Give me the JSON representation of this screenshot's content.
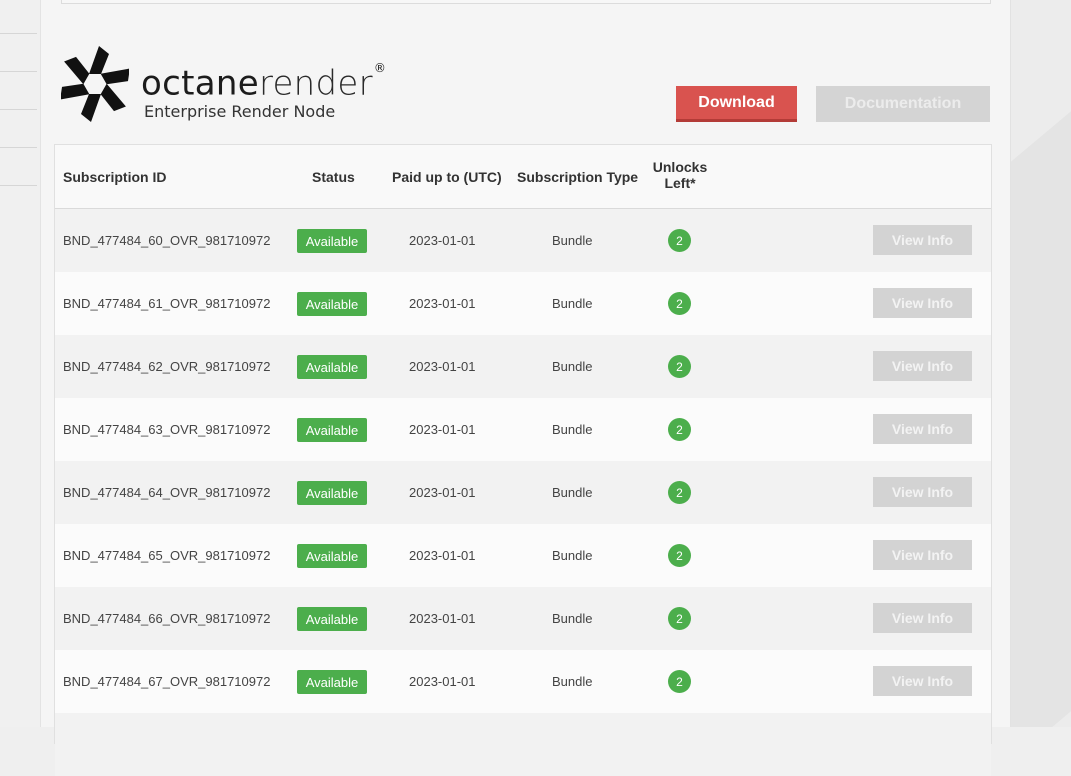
{
  "brand": {
    "name_bold": "octane",
    "name_light": "render",
    "registered": "®",
    "subtitle": "Enterprise Render Node"
  },
  "actions": {
    "download_label": "Download",
    "documentation_label": "Documentation"
  },
  "colors": {
    "download": "#d9534f",
    "available": "#4cae4c",
    "disabled": "#d4d4d4"
  },
  "table": {
    "headers": {
      "subscription_id": "Subscription ID",
      "status": "Status",
      "paid_up_to": "Paid up to (UTC)",
      "subscription_type": "Subscription Type",
      "unlocks_left_line1": "Unlocks",
      "unlocks_left_line2": "Left*"
    },
    "view_label": "View Info",
    "rows": [
      {
        "id": "BND_477484_60_OVR_981710972",
        "status": "Available",
        "paid": "2023-01-01",
        "type": "Bundle",
        "unlocks": "2"
      },
      {
        "id": "BND_477484_61_OVR_981710972",
        "status": "Available",
        "paid": "2023-01-01",
        "type": "Bundle",
        "unlocks": "2"
      },
      {
        "id": "BND_477484_62_OVR_981710972",
        "status": "Available",
        "paid": "2023-01-01",
        "type": "Bundle",
        "unlocks": "2"
      },
      {
        "id": "BND_477484_63_OVR_981710972",
        "status": "Available",
        "paid": "2023-01-01",
        "type": "Bundle",
        "unlocks": "2"
      },
      {
        "id": "BND_477484_64_OVR_981710972",
        "status": "Available",
        "paid": "2023-01-01",
        "type": "Bundle",
        "unlocks": "2"
      },
      {
        "id": "BND_477484_65_OVR_981710972",
        "status": "Available",
        "paid": "2023-01-01",
        "type": "Bundle",
        "unlocks": "2"
      },
      {
        "id": "BND_477484_66_OVR_981710972",
        "status": "Available",
        "paid": "2023-01-01",
        "type": "Bundle",
        "unlocks": "2"
      },
      {
        "id": "BND_477484_67_OVR_981710972",
        "status": "Available",
        "paid": "2023-01-01",
        "type": "Bundle",
        "unlocks": "2"
      }
    ]
  }
}
